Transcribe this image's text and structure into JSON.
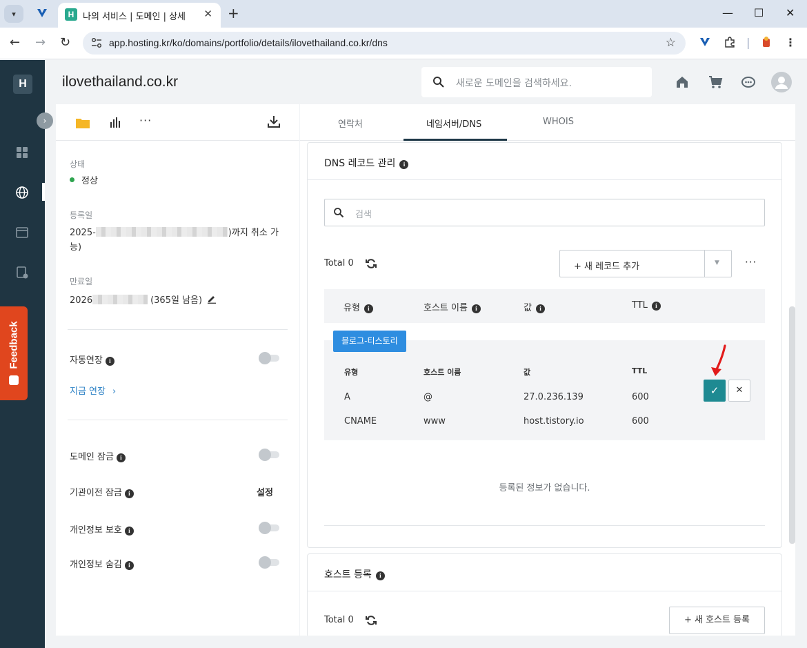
{
  "browser": {
    "tab_title": "나의 서비스 | 도메인 | 상세",
    "tab_favicon": "H",
    "url": "app.hosting.kr/ko/domains/portfolio/details/ilovethailand.co.kr/dns"
  },
  "app": {
    "logo": "H",
    "feedback_label": "Feedback"
  },
  "header": {
    "domain": "ilovethailand.co.kr",
    "search_placeholder": "새로운 도메인을 검색하세요."
  },
  "left": {
    "status_label": "상태",
    "status_value": "정상",
    "registered_label": "등록일",
    "registered_prefix": "2025-",
    "registered_suffix": ")까지 취소 가",
    "registered_line2": "능)",
    "expiry_label": "만료일",
    "expiry_prefix": "2026",
    "expiry_suffix": "(365일 남음)",
    "auto_renew_label": "자동연장",
    "renew_now": "지금 연장",
    "domain_lock_label": "도메인 잠금",
    "transfer_lock_label": "기관이전 잠금",
    "transfer_lock_action": "설정",
    "privacy_label": "개인정보 보호",
    "privacy_hide_label": "개인정보 숨김"
  },
  "tabs": [
    {
      "label": "연락처"
    },
    {
      "label": "네임서버/DNS"
    },
    {
      "label": "WHOIS"
    }
  ],
  "dns": {
    "title": "DNS 레코드 관리",
    "search_placeholder": "검색",
    "total_label": "Total 0",
    "add_record_label": "+ 새 레코드 추가",
    "columns": [
      "유형",
      "호스트 이름",
      "값",
      "TTL"
    ],
    "template": {
      "badge": "블로그-티스토리",
      "columns": [
        "유형",
        "호스트 이름",
        "값",
        "TTL"
      ],
      "rows": [
        [
          "A",
          "@",
          "27.0.236.139",
          "600"
        ],
        [
          "CNAME",
          "www",
          "host.tistory.io",
          "600"
        ]
      ]
    },
    "empty_message": "등록된 정보가 없습니다."
  },
  "host": {
    "title": "호스트 등록",
    "total_label": "Total 0",
    "add_label": "+ 새 호스트 등록"
  },
  "colors": {
    "sidebar": "#1f3542",
    "accent_teal": "#1e8a92",
    "badge_blue": "#2e8de0",
    "feedback": "#e0461e",
    "link": "#2f83c6"
  }
}
